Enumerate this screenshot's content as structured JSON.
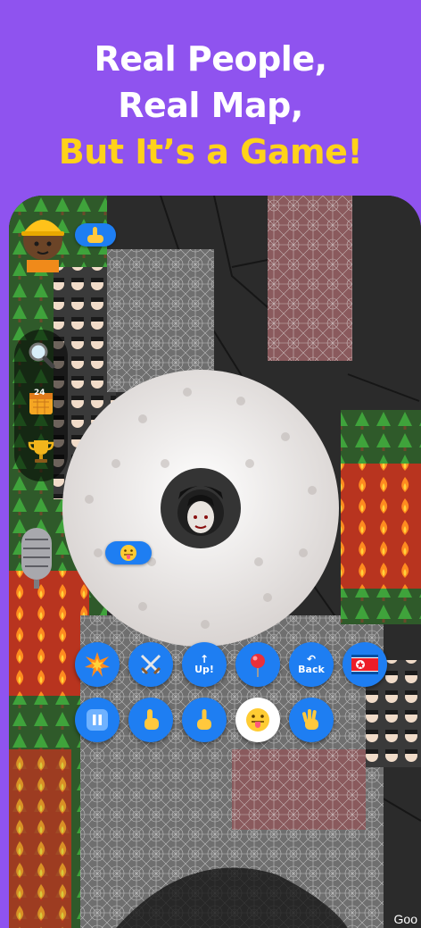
{
  "headline": {
    "line1": "Real People,",
    "line2": "Real Map,",
    "line3": "But It’s a Game!"
  },
  "colors": {
    "background": "#8f53ef",
    "headline_white": "#ffffff",
    "headline_yellow": "#ffd21a",
    "button_blue": "#1e7ef2",
    "map_dark": "#2b2b2b"
  },
  "side_panel": {
    "items": [
      {
        "icon": "magnifier-icon"
      },
      {
        "icon": "calendar-icon",
        "badge": "24"
      },
      {
        "icon": "trophy-icon"
      }
    ]
  },
  "actions_row1": [
    {
      "icon": "explosion-icon"
    },
    {
      "icon": "crossed-swords-icon"
    },
    {
      "icon": "up-arrow-icon",
      "label": "Up!"
    },
    {
      "icon": "pushpin-icon"
    },
    {
      "icon": "back-arrow-icon",
      "label": "Back"
    },
    {
      "icon": "north-korea-flag-icon"
    }
  ],
  "actions_row2": [
    {
      "icon": "pause-icon"
    },
    {
      "icon": "pointing-hand-icon"
    },
    {
      "icon": "middle-finger-icon"
    },
    {
      "icon": "tongue-face-icon",
      "selected": true
    },
    {
      "icon": "waving-hand-icon"
    }
  ],
  "bubbles": [
    {
      "icon": "middle-finger-icon"
    },
    {
      "icon": "tongue-face-icon"
    }
  ],
  "watermark": "Goo"
}
